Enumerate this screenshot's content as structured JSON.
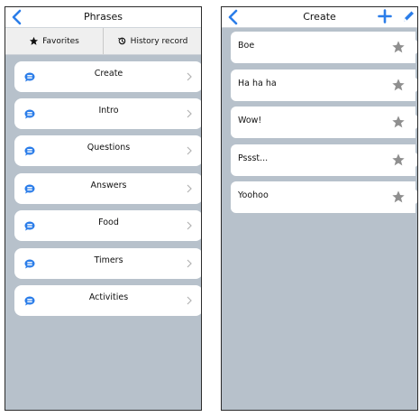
{
  "left_panel": {
    "title": "Phrases",
    "tabs": [
      {
        "label": "Favorites",
        "icon": "star-icon"
      },
      {
        "label": "History record",
        "icon": "history-icon"
      }
    ],
    "categories": [
      {
        "label": "Create"
      },
      {
        "label": "Intro"
      },
      {
        "label": "Questions"
      },
      {
        "label": "Answers"
      },
      {
        "label": "Food"
      },
      {
        "label": "Timers"
      },
      {
        "label": "Activities"
      }
    ]
  },
  "right_panel": {
    "title": "Create",
    "phrases": [
      {
        "text": "Boe"
      },
      {
        "text": "Ha ha ha"
      },
      {
        "text": "Wow!"
      },
      {
        "text": "Pssst..."
      },
      {
        "text": "Yoohoo"
      }
    ]
  },
  "colors": {
    "accent": "#2b7de9",
    "background": "#b7c1cb",
    "row": "#ffffff",
    "star": "#8f8f8f"
  }
}
